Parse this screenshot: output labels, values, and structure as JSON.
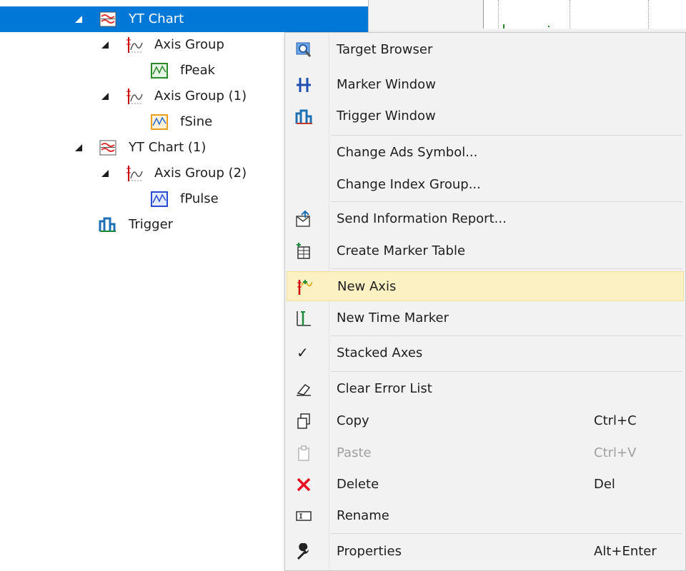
{
  "tree": {
    "items": [
      {
        "label": "YT Chart",
        "icon": "yt-chart-icon"
      },
      {
        "label": "Axis Group",
        "icon": "axis-group-icon"
      },
      {
        "label": "fPeak",
        "icon": "channel-green-icon"
      },
      {
        "label": "Axis Group (1)",
        "icon": "axis-group-icon"
      },
      {
        "label": "fSine",
        "icon": "channel-orange-icon"
      },
      {
        "label": "YT Chart (1)",
        "icon": "yt-chart-icon"
      },
      {
        "label": "Axis Group (2)",
        "icon": "axis-group-icon"
      },
      {
        "label": "fPulse",
        "icon": "channel-blue-icon"
      },
      {
        "label": "Trigger",
        "icon": "trigger-icon"
      }
    ]
  },
  "context_menu": {
    "items": [
      {
        "label": "Target Browser",
        "icon": "target-browser-icon"
      },
      {
        "label": "Marker Window",
        "icon": "marker-window-icon"
      },
      {
        "label": "Trigger Window",
        "icon": "trigger-window-icon"
      },
      {
        "label": "Change Ads Symbol..."
      },
      {
        "label": "Change Index Group..."
      },
      {
        "label": "Send Information Report...",
        "icon": "send-report-icon"
      },
      {
        "label": "Create Marker Table",
        "icon": "marker-table-icon"
      },
      {
        "label": "New Axis",
        "icon": "new-axis-icon",
        "highlighted": true
      },
      {
        "label": "New Time Marker",
        "icon": "time-marker-icon"
      },
      {
        "label": "Stacked Axes",
        "checked": true
      },
      {
        "label": "Clear Error List",
        "icon": "eraser-icon"
      },
      {
        "label": "Copy",
        "shortcut": "Ctrl+C",
        "icon": "copy-icon"
      },
      {
        "label": "Paste",
        "shortcut": "Ctrl+V",
        "icon": "paste-icon",
        "disabled": true
      },
      {
        "label": "Delete",
        "shortcut": "Del",
        "icon": "delete-icon"
      },
      {
        "label": "Rename",
        "icon": "rename-icon"
      },
      {
        "label": "Properties",
        "shortcut": "Alt+Enter",
        "icon": "wrench-icon"
      }
    ],
    "stacked_check_glyph": "✓"
  },
  "colors": {
    "selection": "#0078d7",
    "menu_hover": "#fcf1c2",
    "delete_red": "#e81123"
  }
}
